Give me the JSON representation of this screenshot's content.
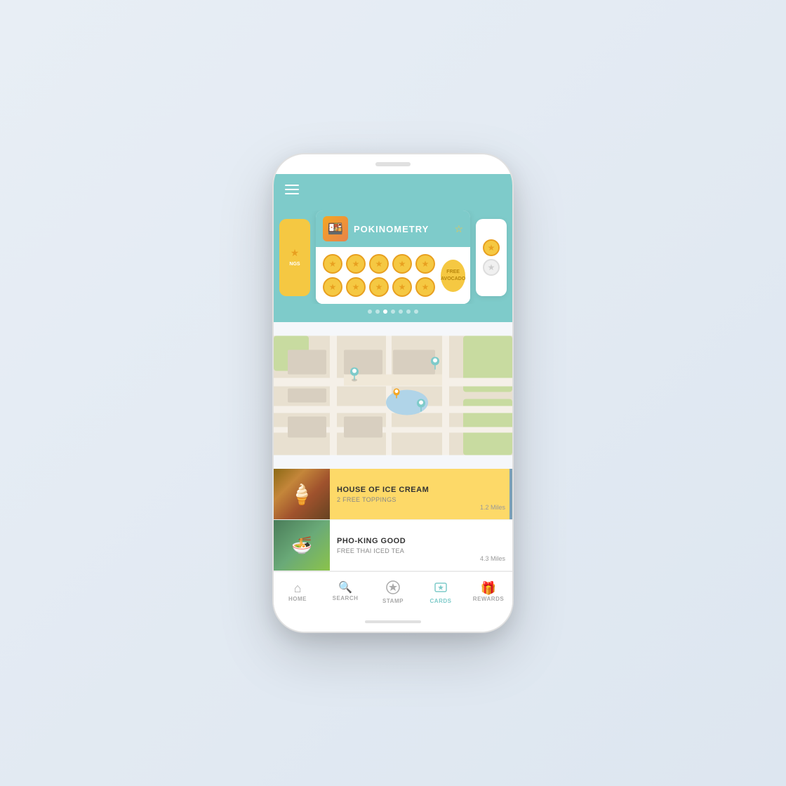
{
  "app": {
    "header": {
      "menu_icon": "hamburger-icon"
    },
    "cards_section": {
      "active_card": {
        "restaurant_name": "POKINOMETRY",
        "food_emoji": "🍱",
        "star_outline": "☆",
        "stamps": [
          {
            "row": 1,
            "filled": [
              true,
              true,
              true,
              true,
              true
            ]
          },
          {
            "row": 2,
            "filled": [
              true,
              true,
              true,
              true,
              true
            ]
          }
        ],
        "badge": {
          "line1": "FREE",
          "line2": "AVOCADO"
        }
      },
      "dots": [
        false,
        false,
        true,
        false,
        false,
        false,
        false
      ]
    },
    "map": {
      "pins": [
        {
          "type": "teal",
          "label": "pin1"
        },
        {
          "type": "teal",
          "label": "pin2"
        },
        {
          "type": "orange",
          "label": "pin3"
        },
        {
          "type": "teal",
          "label": "pin4"
        }
      ]
    },
    "listings": [
      {
        "name": "HOUSE OF ICE CREAM",
        "promo": "2 FREE TOPPINGS",
        "distance": "1.2 Miles",
        "highlighted": true,
        "thumb": "ice"
      },
      {
        "name": "PHO-KING GOOD",
        "promo": "FREE THAI ICED TEA",
        "distance": "4.3 Miles",
        "highlighted": false,
        "thumb": "pho"
      }
    ],
    "bottom_nav": [
      {
        "label": "HOME",
        "icon": "⌂",
        "active": false
      },
      {
        "label": "SEARCH",
        "icon": "🔍",
        "active": false
      },
      {
        "label": "STAMP",
        "icon": "★",
        "active": false
      },
      {
        "label": "CARDS",
        "icon": "☐",
        "active": true
      },
      {
        "label": "REWARDS",
        "icon": "🎁",
        "active": false
      }
    ]
  }
}
